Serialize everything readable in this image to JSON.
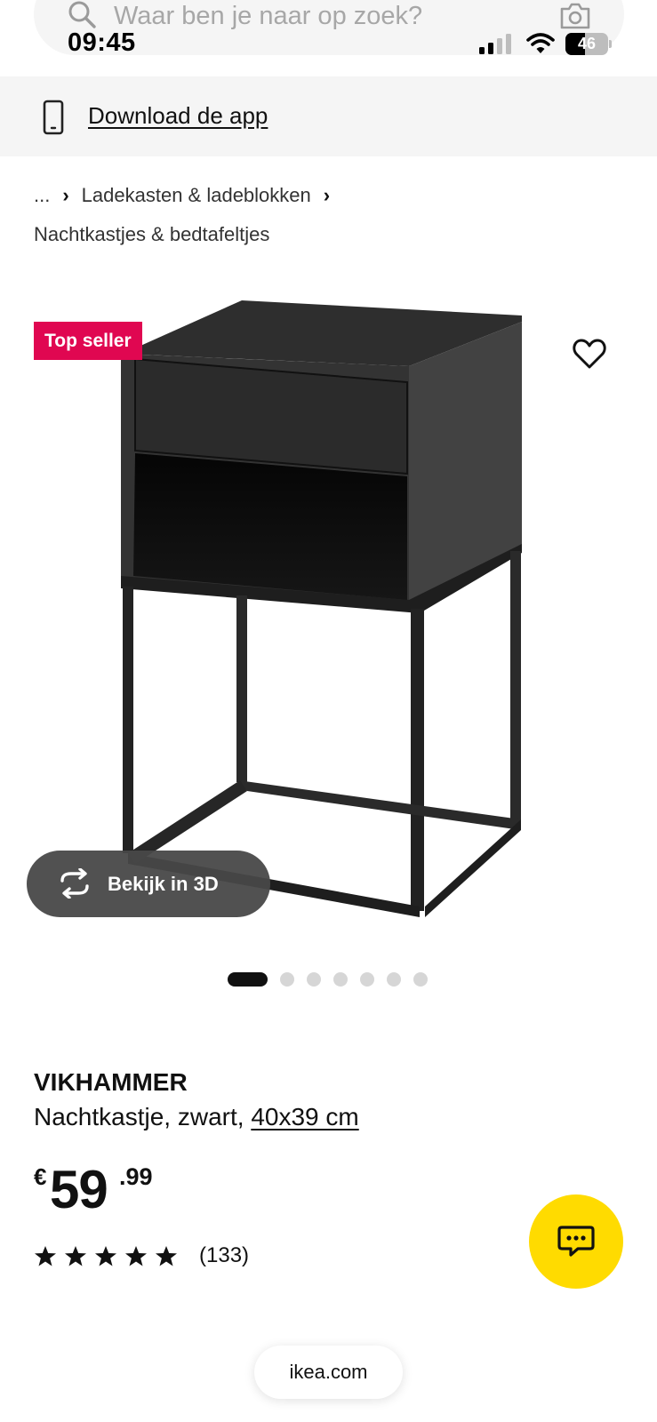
{
  "search": {
    "placeholder": "Waar ben je naar op zoek?"
  },
  "status_bar": {
    "time": "09:45",
    "battery": "46",
    "battery_level": 0.46
  },
  "banner": {
    "download_label": "Download de app"
  },
  "breadcrumb": {
    "ellipsis": "...",
    "items": [
      "Ladekasten & ladeblokken",
      "Nachtkastjes & bedtafeltjes"
    ]
  },
  "product": {
    "badge": "Top seller",
    "view3d_label": "Bekijk in 3D",
    "name": "VIKHAMMER",
    "description": "Nachtkastje, zwart,",
    "size": "40x39 cm",
    "price": {
      "currency": "€",
      "integer": "59",
      "decimal": ".99"
    },
    "rating": {
      "stars": 5,
      "count": "(133)"
    }
  },
  "carousel": {
    "total": 7,
    "active": 0
  },
  "browser": {
    "domain": "ikea.com"
  },
  "colors": {
    "badge": "#e00751",
    "chat_button": "#ffdb00",
    "banner_bg": "#f5f5f5"
  }
}
